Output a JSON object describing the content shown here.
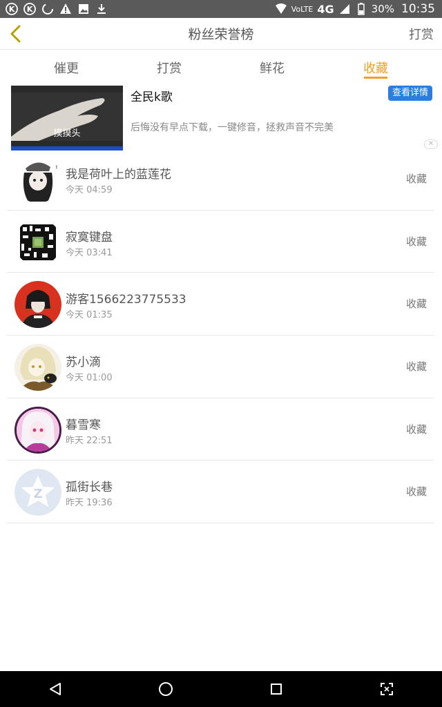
{
  "status_bar": {
    "network_label": "VoLTE",
    "network_type": "4G",
    "battery": "30%",
    "time": "10:35"
  },
  "header": {
    "title": "粉丝荣誉榜",
    "right_action": "打赏"
  },
  "tabs": [
    {
      "label": "催更",
      "active": false
    },
    {
      "label": "打赏",
      "active": false
    },
    {
      "label": "鲜花",
      "active": false
    },
    {
      "label": "收藏",
      "active": true
    }
  ],
  "ad": {
    "image_caption": "摸摸头",
    "title": "全民k歌",
    "description": "后悔没有早点下载，一键修音，拯救声音不完美",
    "button_label": "查看详情",
    "close_label": "✕"
  },
  "fans": [
    {
      "name": "我是荷叶上的蓝莲花",
      "time": "今天 04:59",
      "action": "收藏",
      "avatar": "anime-girl-avatar"
    },
    {
      "name": "寂寞键盘",
      "time": "今天 03:41",
      "action": "收藏",
      "avatar": "qr-code-avatar"
    },
    {
      "name": "游客1566223775533",
      "time": "今天 01:35",
      "action": "收藏",
      "avatar": "anime-boy-red-avatar"
    },
    {
      "name": "苏小滴",
      "time": "今天 01:00",
      "action": "收藏",
      "avatar": "anime-blonde-avatar"
    },
    {
      "name": "暮雪寒",
      "time": "昨天 22:51",
      "action": "收藏",
      "avatar": "anime-pink-avatar"
    },
    {
      "name": "孤街长巷",
      "time": "昨天 19:36",
      "action": "收藏",
      "avatar": "default-star-avatar"
    }
  ],
  "colors": {
    "accent": "#f0a020",
    "ad_button": "#2b7de0",
    "status_bar": "#5a5a5a"
  }
}
